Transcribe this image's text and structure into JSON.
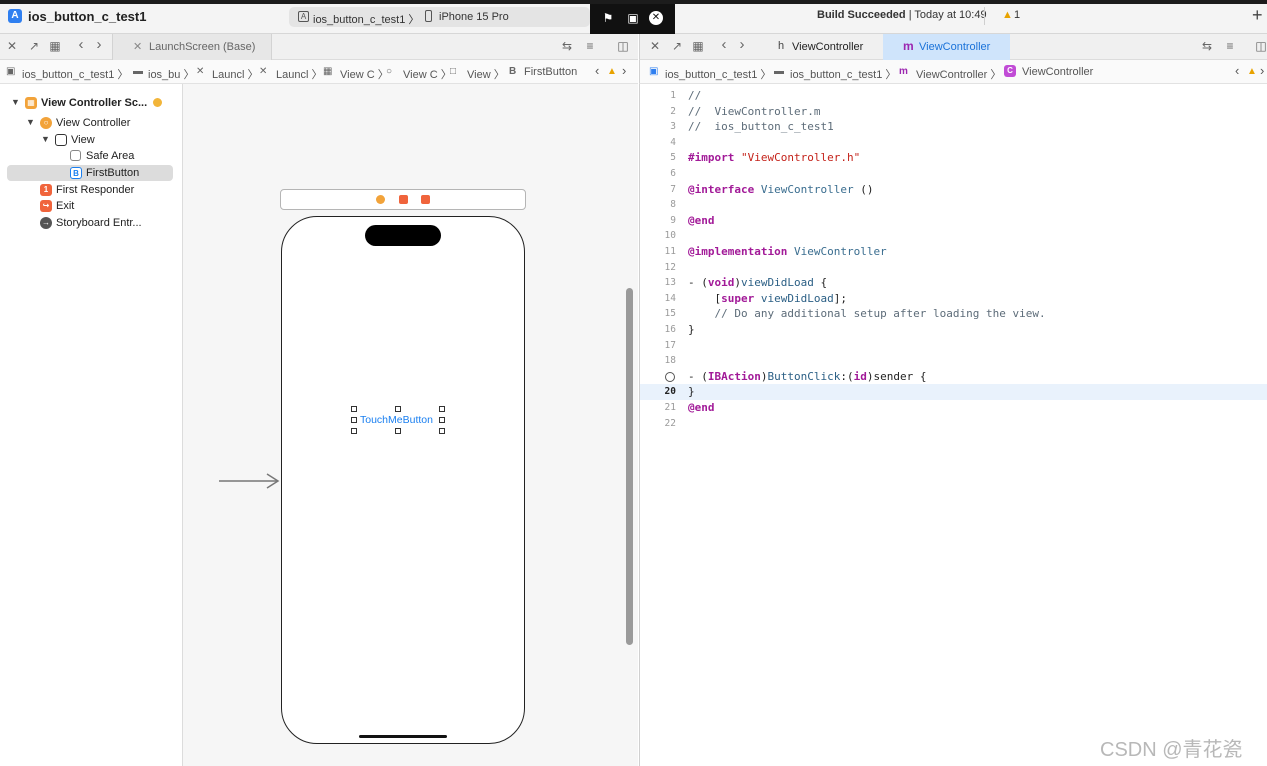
{
  "window": {
    "project_title": "ios_button_c_test1",
    "scheme": "ios_button_c_test1 〉",
    "device": "iPhone 15 Pro",
    "status_bold": "Build Succeeded",
    "status_rest": " | Today at 10:49",
    "warning_count": "1"
  },
  "left_editor": {
    "tab_label": "LaunchScreen (Base)",
    "breadcrumb": [
      "ios_button_c_test1 〉",
      "ios_bu 〉",
      "Launcl 〉",
      "Launcl 〉",
      "View C 〉",
      "View C 〉",
      "View 〉",
      "FirstButton"
    ],
    "outline": [
      {
        "label": "View Controller Sc...",
        "icon": "scene-icon",
        "color": "#f2a33a"
      },
      {
        "label": "View Controller",
        "icon": "view-controller-icon",
        "color": "#f2a33a"
      },
      {
        "label": "View",
        "icon": "view-icon",
        "color": "#333333"
      },
      {
        "label": "Safe Area",
        "icon": "safe-area-icon",
        "color": "#888888"
      },
      {
        "label": "FirstButton",
        "icon": "button-icon",
        "color": "#1a7ff0"
      },
      {
        "label": "First Responder",
        "icon": "first-responder-icon",
        "color": "#f0643c"
      },
      {
        "label": "Exit",
        "icon": "exit-icon",
        "color": "#f0643c"
      },
      {
        "label": "Storyboard Entr...",
        "icon": "storyboard-entry-icon",
        "color": "#555555"
      }
    ],
    "canvas": {
      "button_title": "TouchMeButton"
    }
  },
  "right_editor": {
    "tab_header": "ViewController",
    "tab_impl": "ViewController",
    "breadcrumb": [
      "ios_button_c_test1 〉",
      "ios_button_c_test1 〉",
      "ViewController 〉",
      "ViewController"
    ],
    "current_line": 20,
    "lines": [
      "//",
      "//  ViewController.m",
      "//  ios_button_c_test1",
      "",
      "#import \"ViewController.h\"",
      "",
      "@interface ViewController ()",
      "",
      "@end",
      "",
      "@implementation ViewController",
      "",
      "- (void)viewDidLoad {",
      "    [super viewDidLoad];",
      "    // Do any additional setup after loading the view.",
      "}",
      "",
      "",
      "- (IBAction)ButtonClick:(id)sender {",
      "}",
      "@end",
      ""
    ]
  },
  "watermark": "CSDN @青花瓷",
  "colors": {
    "accent": "#1a7ff0",
    "keyword": "#a21a98",
    "string": "#c4221a",
    "warning": "#e8a300"
  }
}
